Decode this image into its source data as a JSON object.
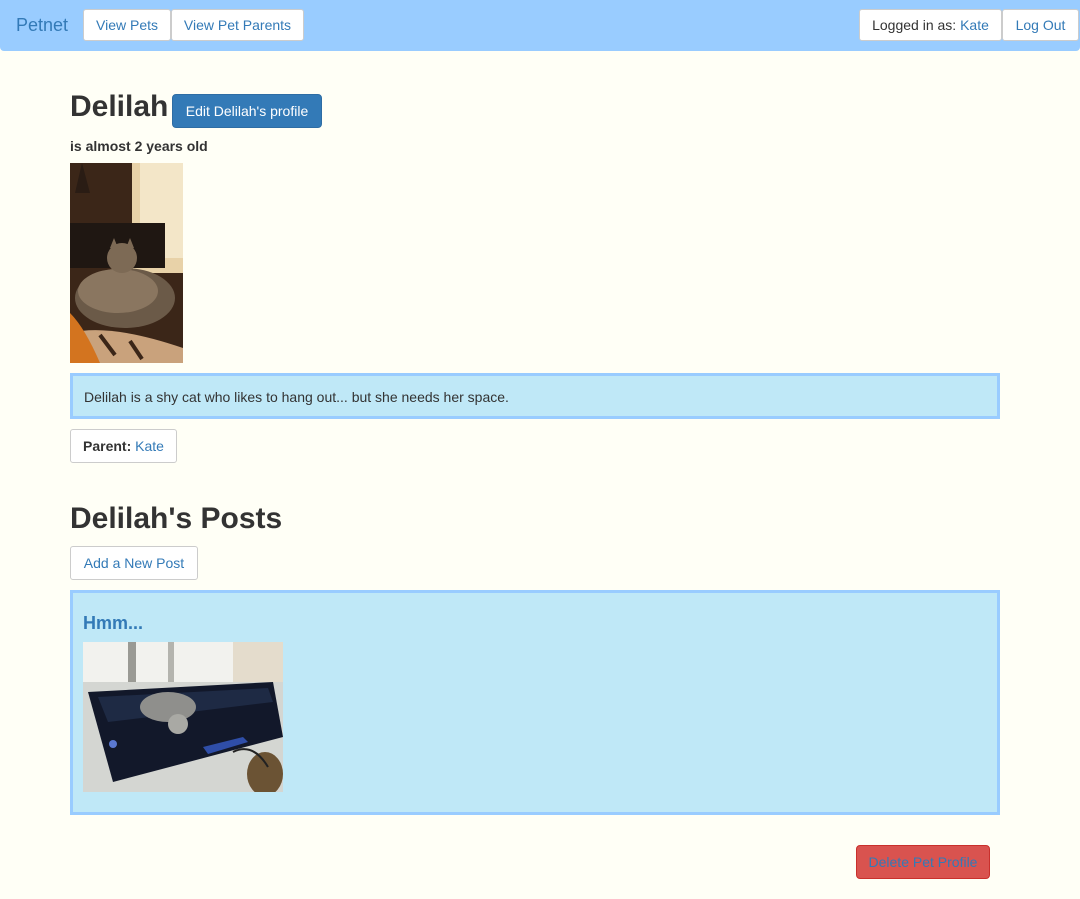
{
  "nav": {
    "brand": "Petnet",
    "view_pets": "View Pets",
    "view_pet_parents": "View Pet Parents",
    "logged_in_label": "Logged in as:",
    "logged_in_user": "Kate",
    "logout": "Log Out"
  },
  "pet": {
    "name": "Delilah",
    "edit_button": "Edit Delilah's profile",
    "age_text": "is almost 2 years old",
    "description": "Delilah is a shy cat who likes to hang out... but she needs her space.",
    "parent_label": "Parent:",
    "parent_name": "Kate"
  },
  "posts": {
    "heading": "Delilah's Posts",
    "add_button": "Add a New Post",
    "items": [
      {
        "title": "Hmm..."
      }
    ]
  },
  "actions": {
    "delete_button": "Delete Pet Profile"
  },
  "colors": {
    "navbar": "#99ccff",
    "background": "#fffff6",
    "link": "#337ab7",
    "panel": "#bfe8f7",
    "panel_border": "#99ccff",
    "danger": "#d9534f"
  }
}
